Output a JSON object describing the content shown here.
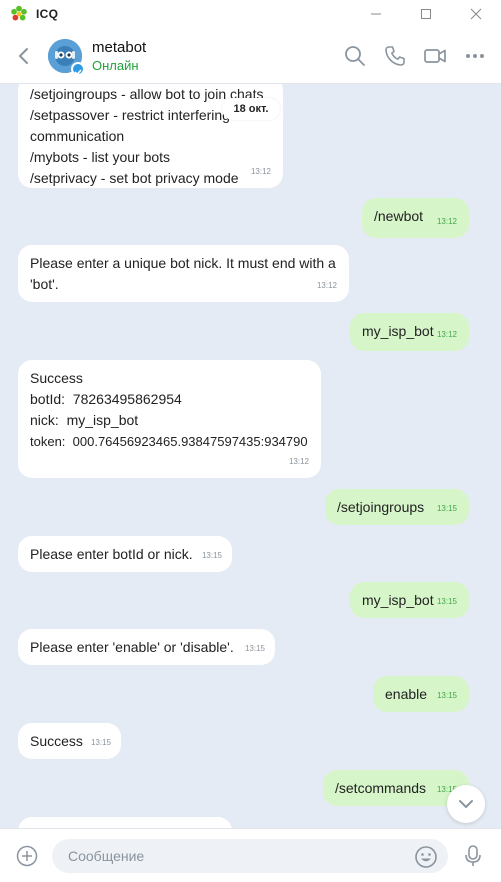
{
  "app": {
    "name": "ICQ"
  },
  "window": {
    "minimize": "—",
    "maximize": "☐",
    "close": "✕"
  },
  "header": {
    "contact_name": "metabot",
    "status": "Онлайн"
  },
  "date_chip": "18 окт.",
  "messages": [
    {
      "dir": "in",
      "lines": [
        "/setjoingroups - allow bot to join chats",
        "/setpassover - restrict interfering",
        "communication",
        "/mybots - list your bots",
        "/setprivacy - set bot privacy mode"
      ],
      "time": "13:12"
    },
    {
      "dir": "out",
      "lines": [
        "/newbot"
      ],
      "time": "13:12"
    },
    {
      "dir": "in",
      "lines": [
        "Please enter a unique bot nick. It must end with a",
        "'bot'."
      ],
      "time": "13:12"
    },
    {
      "dir": "out",
      "lines": [
        "my_isp_bot"
      ],
      "time": "13:12"
    },
    {
      "dir": "in",
      "lines": [
        "Success",
        "botId:  78263495862954",
        "nick:  my_isp_bot",
        "token:  000.76456923465.93847597435:934790"
      ],
      "time": "13:12"
    },
    {
      "dir": "out",
      "lines": [
        "/setjoingroups"
      ],
      "time": "13:15"
    },
    {
      "dir": "in",
      "lines": [
        "Please enter botId or nick."
      ],
      "time": "13:15"
    },
    {
      "dir": "out",
      "lines": [
        "my_isp_bot"
      ],
      "time": "13:15"
    },
    {
      "dir": "in",
      "lines": [
        "Please enter 'enable' or 'disable'."
      ],
      "time": "13:15"
    },
    {
      "dir": "out",
      "lines": [
        "enable"
      ],
      "time": "13:15"
    },
    {
      "dir": "in",
      "lines": [
        "Success"
      ],
      "time": "13:15"
    },
    {
      "dir": "out",
      "lines": [
        "/setcommands"
      ],
      "time": "13:15"
    }
  ],
  "input": {
    "placeholder": "Сообщение"
  },
  "colors": {
    "accent": "#2f9be0",
    "online": "#1fa43b",
    "outgoing": "#d6f5c9",
    "background": "#e4ebf4"
  }
}
